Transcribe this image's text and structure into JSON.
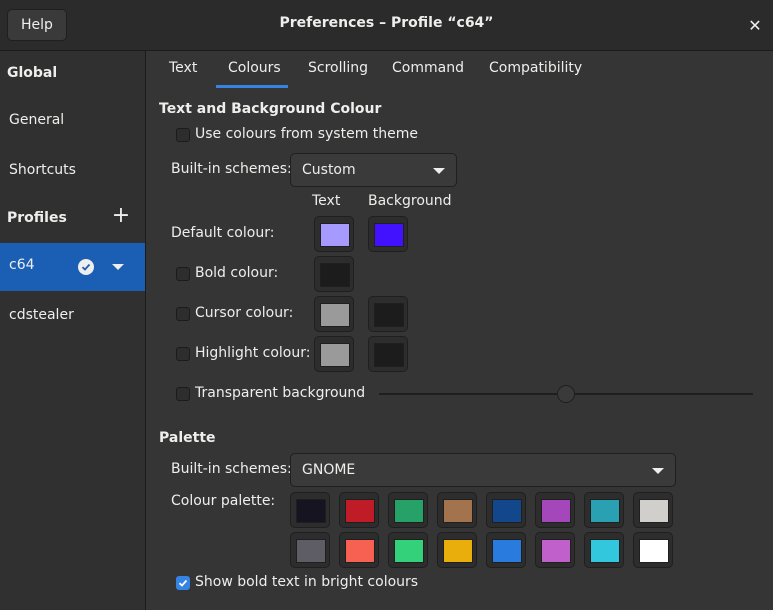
{
  "header": {
    "help_label": "Help",
    "title": "Preferences – Profile “c64”",
    "close_glyph": "✕"
  },
  "sidebar": {
    "global_header": "Global",
    "items": [
      {
        "label": "General"
      },
      {
        "label": "Shortcuts"
      }
    ],
    "profiles_header": "Profiles",
    "add_glyph": "+",
    "profiles": [
      {
        "label": "c64",
        "selected": true,
        "default": true
      },
      {
        "label": "cdstealer",
        "selected": false
      }
    ]
  },
  "tabs": [
    {
      "label": "Text",
      "active": false
    },
    {
      "label": "Colours",
      "active": true
    },
    {
      "label": "Scrolling",
      "active": false
    },
    {
      "label": "Command",
      "active": false
    },
    {
      "label": "Compatibility",
      "active": false
    }
  ],
  "text_bg": {
    "section_title": "Text and Background Colour",
    "use_system_theme": {
      "label": "Use colours from system theme",
      "checked": false
    },
    "builtin_label": "Built-in schemes:",
    "builtin_value": "Custom",
    "col_text": "Text",
    "col_background": "Background",
    "default_colour": {
      "label": "Default colour:",
      "text": "#a79aff",
      "background": "#4212ff"
    },
    "bold_colour": {
      "label": "Bold colour:",
      "checked": false,
      "text": "#1c1c1c"
    },
    "cursor_colour": {
      "label": "Cursor colour:",
      "checked": false,
      "text": "#9a9a9a",
      "background": "#1c1c1c"
    },
    "highlight_colour": {
      "label": "Highlight colour:",
      "checked": false,
      "text": "#9a9a9a",
      "background": "#1c1c1c"
    },
    "transparent_bg": {
      "label": "Transparent background",
      "checked": false,
      "level": 0.5
    }
  },
  "palette": {
    "section_title": "Palette",
    "builtin_label": "Built-in schemes:",
    "builtin_value": "GNOME",
    "colour_palette_label": "Colour palette:",
    "row1": [
      "#171421",
      "#c01c28",
      "#26a269",
      "#a2734c",
      "#12488b",
      "#a347ba",
      "#2aa1b3",
      "#d0cfcc"
    ],
    "row2": [
      "#5e5c64",
      "#f66151",
      "#33d17a",
      "#e9ad0c",
      "#2a7bde",
      "#c061cb",
      "#33c7de",
      "#ffffff"
    ],
    "bold_bright": {
      "label": "Show bold text in bright colours",
      "checked": true
    }
  }
}
